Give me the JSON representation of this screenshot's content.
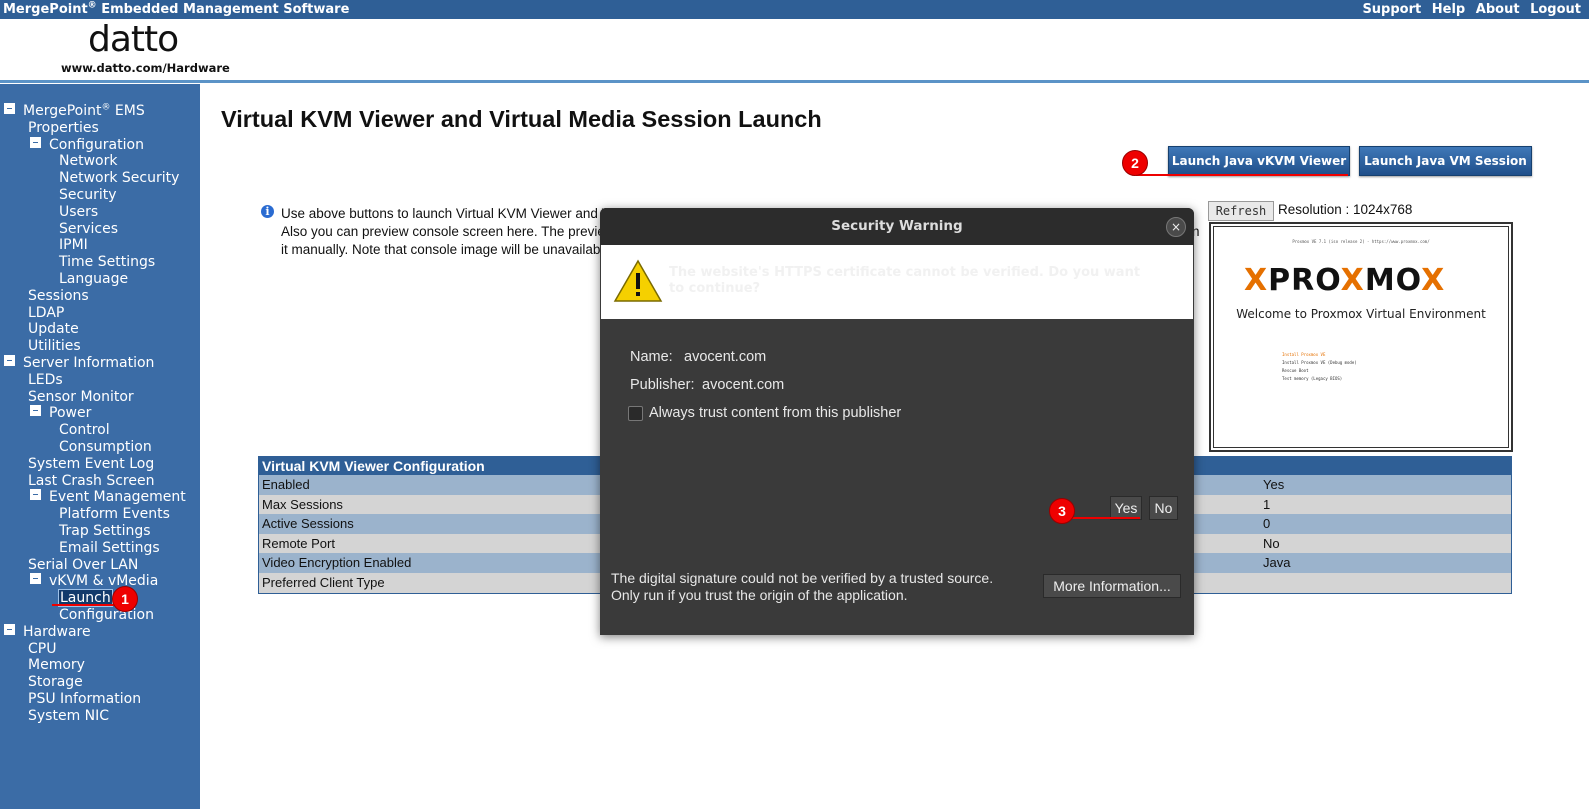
{
  "topbar": {
    "title": "MergePoint",
    "title_sup": "®",
    "title_rest": " Embedded Management Software",
    "links": [
      "Support",
      "Help",
      "About",
      "Logout"
    ]
  },
  "header": {
    "logo_word": "datto",
    "logo_url": "www.datto.com/Hardware"
  },
  "sidebar": {
    "items": [
      {
        "label": "MergePoint",
        "sup": "®",
        "rest": " EMS",
        "level": 0,
        "toggle": true
      },
      {
        "label": "Properties",
        "level": 1
      },
      {
        "label": "Configuration",
        "level": 1,
        "toggle": true
      },
      {
        "label": "Network",
        "level": 2
      },
      {
        "label": "Network Security",
        "level": 2
      },
      {
        "label": "Security",
        "level": 2
      },
      {
        "label": "Users",
        "level": 2
      },
      {
        "label": "Services",
        "level": 2
      },
      {
        "label": "IPMI",
        "level": 2
      },
      {
        "label": "Time Settings",
        "level": 2
      },
      {
        "label": "Language",
        "level": 2
      },
      {
        "label": "Sessions",
        "level": 1
      },
      {
        "label": "LDAP",
        "level": 1
      },
      {
        "label": "Update",
        "level": 1
      },
      {
        "label": "Utilities",
        "level": 1
      },
      {
        "label": "Server Information",
        "level": 0,
        "toggle": true
      },
      {
        "label": "LEDs",
        "level": 1
      },
      {
        "label": "Sensor Monitor",
        "level": 1
      },
      {
        "label": "Power",
        "level": 1,
        "toggle": true
      },
      {
        "label": "Control",
        "level": 2
      },
      {
        "label": "Consumption",
        "level": 2
      },
      {
        "label": "System Event Log",
        "level": 1
      },
      {
        "label": "Last Crash Screen",
        "level": 1
      },
      {
        "label": "Event Management",
        "level": 1,
        "toggle": true
      },
      {
        "label": "Platform Events",
        "level": 2
      },
      {
        "label": "Trap Settings",
        "level": 2
      },
      {
        "label": "Email Settings",
        "level": 2
      },
      {
        "label": "Serial Over LAN",
        "level": 1
      },
      {
        "label": "vKVM & vMedia",
        "level": 1,
        "toggle": true
      },
      {
        "label": "Launch",
        "level": 2,
        "selected": true
      },
      {
        "label": "Configuration",
        "level": 2
      },
      {
        "label": "Hardware",
        "level": 0,
        "toggle": true
      },
      {
        "label": "CPU",
        "level": 1
      },
      {
        "label": "Memory",
        "level": 1
      },
      {
        "label": "Storage",
        "level": 1
      },
      {
        "label": "PSU Information",
        "level": 1
      },
      {
        "label": "System NIC",
        "level": 1
      }
    ]
  },
  "main": {
    "title": "Virtual KVM Viewer and Virtual Media Session Launch",
    "launch_kvm_label": "Launch Java vKVM Viewer",
    "launch_vm_label": "Launch Java VM Session",
    "info_line1": "Use above buttons to launch Virtual KVM Viewer and V",
    "info_line2": "Also you can preview console screen here. The previe",
    "info_line2_tail": "n",
    "info_line3": "it manually. Note that console image will be unavailable",
    "refresh_label": "Refresh",
    "resolution": "Resolution : 1024x768"
  },
  "preview": {
    "top_text": "Proxmox VE 7.1 (iso release 2) - https://www.proxmox.com/",
    "logo_x": "X",
    "logo_pro": "PRO",
    "logo_x2": "X",
    "logo_mo": "MO",
    "logo_x3": "X",
    "welcome": "Welcome to Proxmox Virtual Environment",
    "menu": [
      "Install Proxmox VE",
      "Install Proxmox VE (Debug mode)",
      "Rescue Boot",
      "Test memory (Legacy BIOS)"
    ]
  },
  "config_table": {
    "heading": "Virtual KVM Viewer Configuration",
    "rows": [
      {
        "key": "Enabled",
        "value": "Yes"
      },
      {
        "key": "Max Sessions",
        "value": "1"
      },
      {
        "key": "Active Sessions",
        "value": "0"
      },
      {
        "key": "Remote Port",
        "value": "No"
      },
      {
        "key": "Video Encryption Enabled",
        "value": "Java"
      },
      {
        "key": "Preferred Client Type",
        "value": ""
      }
    ]
  },
  "dialog": {
    "title": "Security Warning",
    "close_glyph": "×",
    "warning_message": "The website's HTTPS certificate cannot be verified. Do you want to continue?",
    "name_label": "Name:",
    "name_value": "avocent.com",
    "publisher_label": "Publisher:",
    "publisher_value": "avocent.com",
    "always_trust_label": "Always trust content from this publisher",
    "yes_label": "Yes",
    "no_label": "No",
    "signature_line1": "The digital signature could not be verified by a trusted source.",
    "signature_line2": "Only run if you trust the origin of the application.",
    "more_info_label": "More Information..."
  },
  "markers": {
    "m1": "1",
    "m2": "2",
    "m3": "3",
    "color": "#e00000"
  }
}
